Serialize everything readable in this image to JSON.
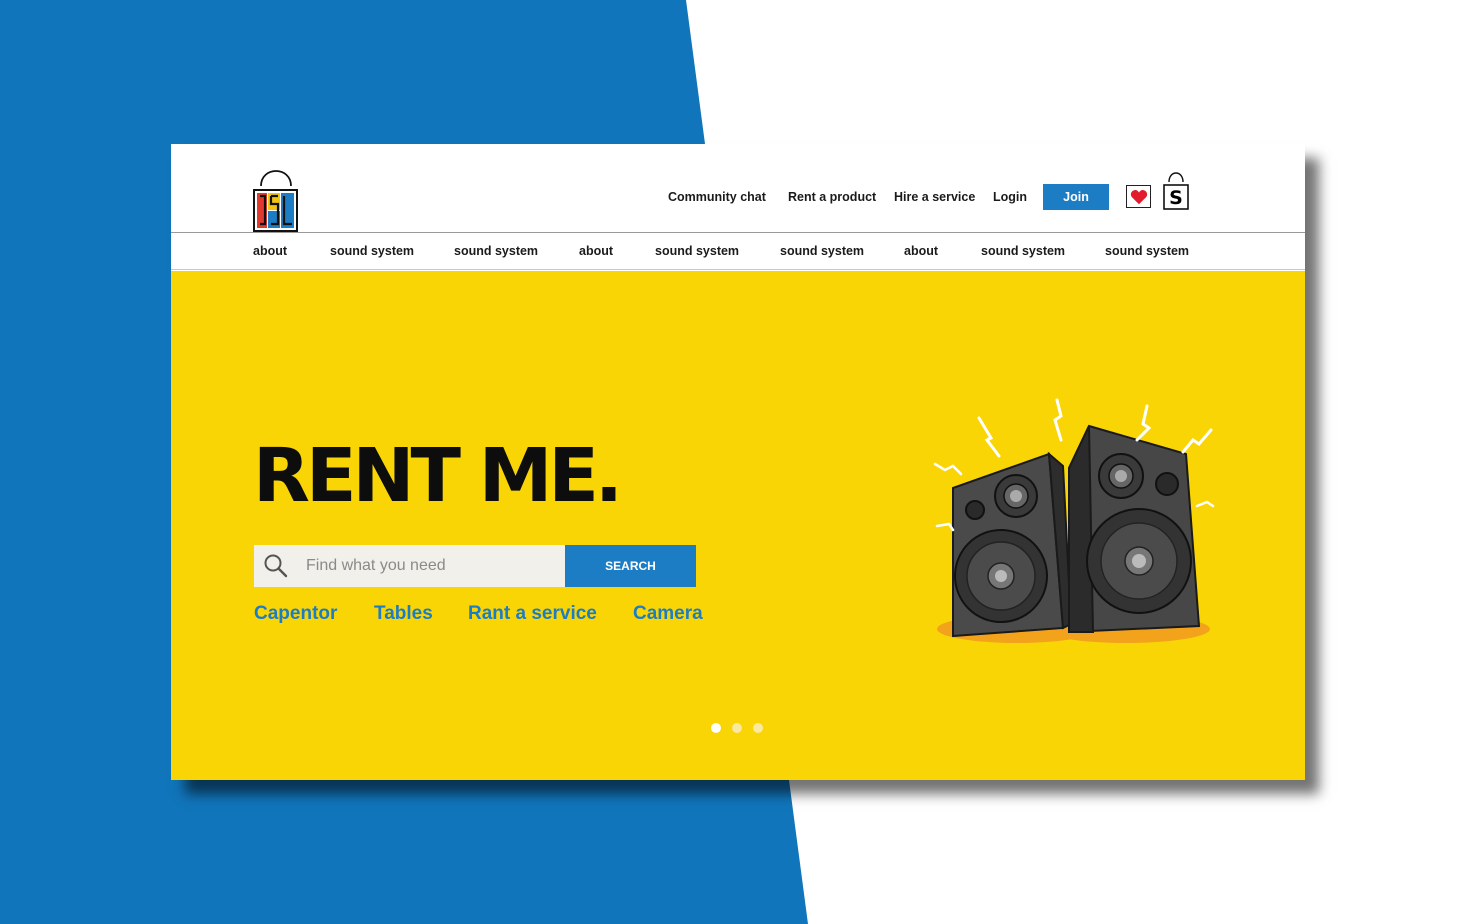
{
  "brand": {
    "logo_icon": "shopping-bag-logo-icon",
    "colors": {
      "blue": "#1175bb",
      "accent": "#1d7dc4",
      "yellow": "#f9d506"
    }
  },
  "header": {
    "links": [
      "Community chat",
      "Rent a product",
      "Hire a service",
      "Login"
    ],
    "join_label": "Join",
    "wishlist_icon": "heart-icon",
    "bag_icon": "shopping-bag-icon",
    "bag_letter": "S"
  },
  "nav": {
    "items": [
      "about",
      "sound system",
      "sound system",
      "about",
      "sound system",
      "sound system",
      "about",
      "sound system",
      "sound system"
    ]
  },
  "hero": {
    "title": "RENT ME.",
    "search": {
      "placeholder": "Find what you need",
      "button_label": "SEARCH",
      "icon": "search-icon"
    },
    "quick_links": [
      "Capentor",
      "Tables",
      "Rant a service",
      "Camera"
    ],
    "carousel": {
      "total": 3,
      "active": 1
    },
    "illustration": "speakers-illustration"
  }
}
